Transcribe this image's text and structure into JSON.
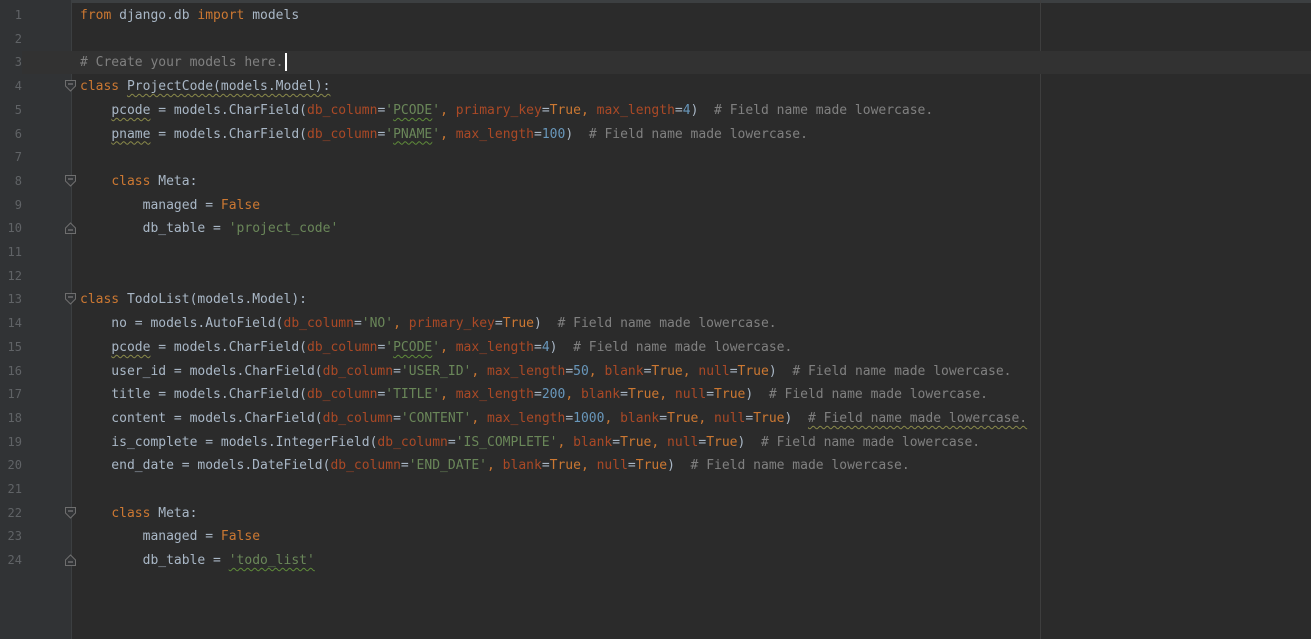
{
  "editor": {
    "language": "python",
    "current_line": 3,
    "colors": {
      "background": "#2b2b2b",
      "gutter": "#313335",
      "keyword": "#cc7832",
      "string": "#6a8759",
      "number": "#6897bb",
      "comment": "#808080",
      "keyword_argument": "#aa4926",
      "text": "#a9b7c6"
    },
    "lines": [
      {
        "n": "1",
        "code": [
          [
            "kw",
            "from"
          ],
          [
            "p",
            " django.db "
          ],
          [
            "kw",
            "import"
          ],
          [
            "p",
            " models"
          ]
        ]
      },
      {
        "n": "2",
        "code": []
      },
      {
        "n": "3",
        "code": [
          [
            "c",
            "# Create your models here."
          ]
        ]
      },
      {
        "n": "4",
        "fold": "open",
        "code": [
          [
            "kw",
            "class"
          ],
          [
            "p",
            " "
          ],
          [
            "sq",
            "ProjectCode(models.Model):"
          ]
        ]
      },
      {
        "n": "5",
        "code": [
          [
            "p",
            "    "
          ],
          [
            "sq",
            "pcode"
          ],
          [
            "p",
            " = models.CharField("
          ],
          [
            "kwa",
            "db_column"
          ],
          [
            "p",
            "="
          ],
          [
            "str",
            "'"
          ],
          [
            "strsq",
            "PCODE"
          ],
          [
            "str",
            "'"
          ],
          [
            "kw",
            ", "
          ],
          [
            "kwa",
            "primary_key"
          ],
          [
            "p",
            "="
          ],
          [
            "kw",
            "True"
          ],
          [
            "kw",
            ", "
          ],
          [
            "kwa",
            "max_length"
          ],
          [
            "p",
            "="
          ],
          [
            "num",
            "4"
          ],
          [
            "p",
            ")  "
          ],
          [
            "c",
            "# Field name made lowercase."
          ]
        ]
      },
      {
        "n": "6",
        "code": [
          [
            "p",
            "    "
          ],
          [
            "sq",
            "pname"
          ],
          [
            "p",
            " = models.CharField("
          ],
          [
            "kwa",
            "db_column"
          ],
          [
            "p",
            "="
          ],
          [
            "str",
            "'"
          ],
          [
            "strsq",
            "PNAME"
          ],
          [
            "str",
            "'"
          ],
          [
            "kw",
            ", "
          ],
          [
            "kwa",
            "max_length"
          ],
          [
            "p",
            "="
          ],
          [
            "num",
            "100"
          ],
          [
            "p",
            ")  "
          ],
          [
            "c",
            "# Field name made lowercase."
          ]
        ]
      },
      {
        "n": "7",
        "code": []
      },
      {
        "n": "8",
        "fold": "open",
        "code": [
          [
            "p",
            "    "
          ],
          [
            "kw",
            "class"
          ],
          [
            "p",
            " Meta:"
          ]
        ]
      },
      {
        "n": "9",
        "code": [
          [
            "p",
            "        managed = "
          ],
          [
            "kw",
            "False"
          ]
        ]
      },
      {
        "n": "10",
        "fold": "end",
        "code": [
          [
            "p",
            "        db_table = "
          ],
          [
            "str",
            "'project_code'"
          ]
        ]
      },
      {
        "n": "11",
        "code": []
      },
      {
        "n": "12",
        "code": []
      },
      {
        "n": "13",
        "fold": "open",
        "code": [
          [
            "kw",
            "class"
          ],
          [
            "p",
            " TodoList(models.Model):"
          ]
        ]
      },
      {
        "n": "14",
        "code": [
          [
            "p",
            "    no = models.AutoField("
          ],
          [
            "kwa",
            "db_column"
          ],
          [
            "p",
            "="
          ],
          [
            "str",
            "'NO'"
          ],
          [
            "kw",
            ", "
          ],
          [
            "kwa",
            "primary_key"
          ],
          [
            "p",
            "="
          ],
          [
            "kw",
            "True"
          ],
          [
            "p",
            ")  "
          ],
          [
            "c",
            "# Field name made lowercase."
          ]
        ]
      },
      {
        "n": "15",
        "code": [
          [
            "p",
            "    "
          ],
          [
            "sq",
            "pcode"
          ],
          [
            "p",
            " = models.CharField("
          ],
          [
            "kwa",
            "db_column"
          ],
          [
            "p",
            "="
          ],
          [
            "str",
            "'"
          ],
          [
            "strsq",
            "PCODE"
          ],
          [
            "str",
            "'"
          ],
          [
            "kw",
            ", "
          ],
          [
            "kwa",
            "max_length"
          ],
          [
            "p",
            "="
          ],
          [
            "num",
            "4"
          ],
          [
            "p",
            ")  "
          ],
          [
            "c",
            "# Field name made lowercase."
          ]
        ]
      },
      {
        "n": "16",
        "code": [
          [
            "p",
            "    user_id = models.CharField("
          ],
          [
            "kwa",
            "db_column"
          ],
          [
            "p",
            "="
          ],
          [
            "str",
            "'USER_ID'"
          ],
          [
            "kw",
            ", "
          ],
          [
            "kwa",
            "max_length"
          ],
          [
            "p",
            "="
          ],
          [
            "num",
            "50"
          ],
          [
            "kw",
            ", "
          ],
          [
            "kwa",
            "blank"
          ],
          [
            "p",
            "="
          ],
          [
            "kw",
            "True"
          ],
          [
            "kw",
            ", "
          ],
          [
            "kwa",
            "null"
          ],
          [
            "p",
            "="
          ],
          [
            "kw",
            "True"
          ],
          [
            "p",
            ")  "
          ],
          [
            "c",
            "# Field name made lowercase."
          ]
        ]
      },
      {
        "n": "17",
        "code": [
          [
            "p",
            "    title = models.CharField("
          ],
          [
            "kwa",
            "db_column"
          ],
          [
            "p",
            "="
          ],
          [
            "str",
            "'TITLE'"
          ],
          [
            "kw",
            ", "
          ],
          [
            "kwa",
            "max_length"
          ],
          [
            "p",
            "="
          ],
          [
            "num",
            "200"
          ],
          [
            "kw",
            ", "
          ],
          [
            "kwa",
            "blank"
          ],
          [
            "p",
            "="
          ],
          [
            "kw",
            "True"
          ],
          [
            "kw",
            ", "
          ],
          [
            "kwa",
            "null"
          ],
          [
            "p",
            "="
          ],
          [
            "kw",
            "True"
          ],
          [
            "p",
            ")  "
          ],
          [
            "c",
            "# Field name made lowercase."
          ]
        ]
      },
      {
        "n": "18",
        "code": [
          [
            "p",
            "    content = models.CharField("
          ],
          [
            "kwa",
            "db_column"
          ],
          [
            "p",
            "="
          ],
          [
            "str",
            "'CONTENT'"
          ],
          [
            "kw",
            ", "
          ],
          [
            "kwa",
            "max_length"
          ],
          [
            "p",
            "="
          ],
          [
            "num",
            "1000"
          ],
          [
            "kw",
            ", "
          ],
          [
            "kwa",
            "blank"
          ],
          [
            "p",
            "="
          ],
          [
            "kw",
            "True"
          ],
          [
            "kw",
            ", "
          ],
          [
            "kwa",
            "null"
          ],
          [
            "p",
            "="
          ],
          [
            "kw",
            "True"
          ],
          [
            "p",
            ")  "
          ],
          [
            "csq",
            "# Field name made lowercase."
          ]
        ]
      },
      {
        "n": "19",
        "code": [
          [
            "p",
            "    is_complete = models.IntegerField("
          ],
          [
            "kwa",
            "db_column"
          ],
          [
            "p",
            "="
          ],
          [
            "str",
            "'IS_COMPLETE'"
          ],
          [
            "kw",
            ", "
          ],
          [
            "kwa",
            "blank"
          ],
          [
            "p",
            "="
          ],
          [
            "kw",
            "True"
          ],
          [
            "kw",
            ", "
          ],
          [
            "kwa",
            "null"
          ],
          [
            "p",
            "="
          ],
          [
            "kw",
            "True"
          ],
          [
            "p",
            ")  "
          ],
          [
            "c",
            "# Field name made lowercase."
          ]
        ]
      },
      {
        "n": "20",
        "code": [
          [
            "p",
            "    end_date = models.DateField("
          ],
          [
            "kwa",
            "db_column"
          ],
          [
            "p",
            "="
          ],
          [
            "str",
            "'END_DATE'"
          ],
          [
            "kw",
            ", "
          ],
          [
            "kwa",
            "blank"
          ],
          [
            "p",
            "="
          ],
          [
            "kw",
            "True"
          ],
          [
            "kw",
            ", "
          ],
          [
            "kwa",
            "null"
          ],
          [
            "p",
            "="
          ],
          [
            "kw",
            "True"
          ],
          [
            "p",
            ")  "
          ],
          [
            "c",
            "# Field name made lowercase."
          ]
        ]
      },
      {
        "n": "21",
        "code": []
      },
      {
        "n": "22",
        "fold": "open",
        "code": [
          [
            "p",
            "    "
          ],
          [
            "kw",
            "class"
          ],
          [
            "p",
            " Meta:"
          ]
        ]
      },
      {
        "n": "23",
        "code": [
          [
            "p",
            "        managed = "
          ],
          [
            "kw",
            "False"
          ]
        ]
      },
      {
        "n": "24",
        "fold": "end",
        "code": [
          [
            "p",
            "        db_table = "
          ],
          [
            "strsq",
            "'todo_list'"
          ]
        ]
      }
    ]
  }
}
